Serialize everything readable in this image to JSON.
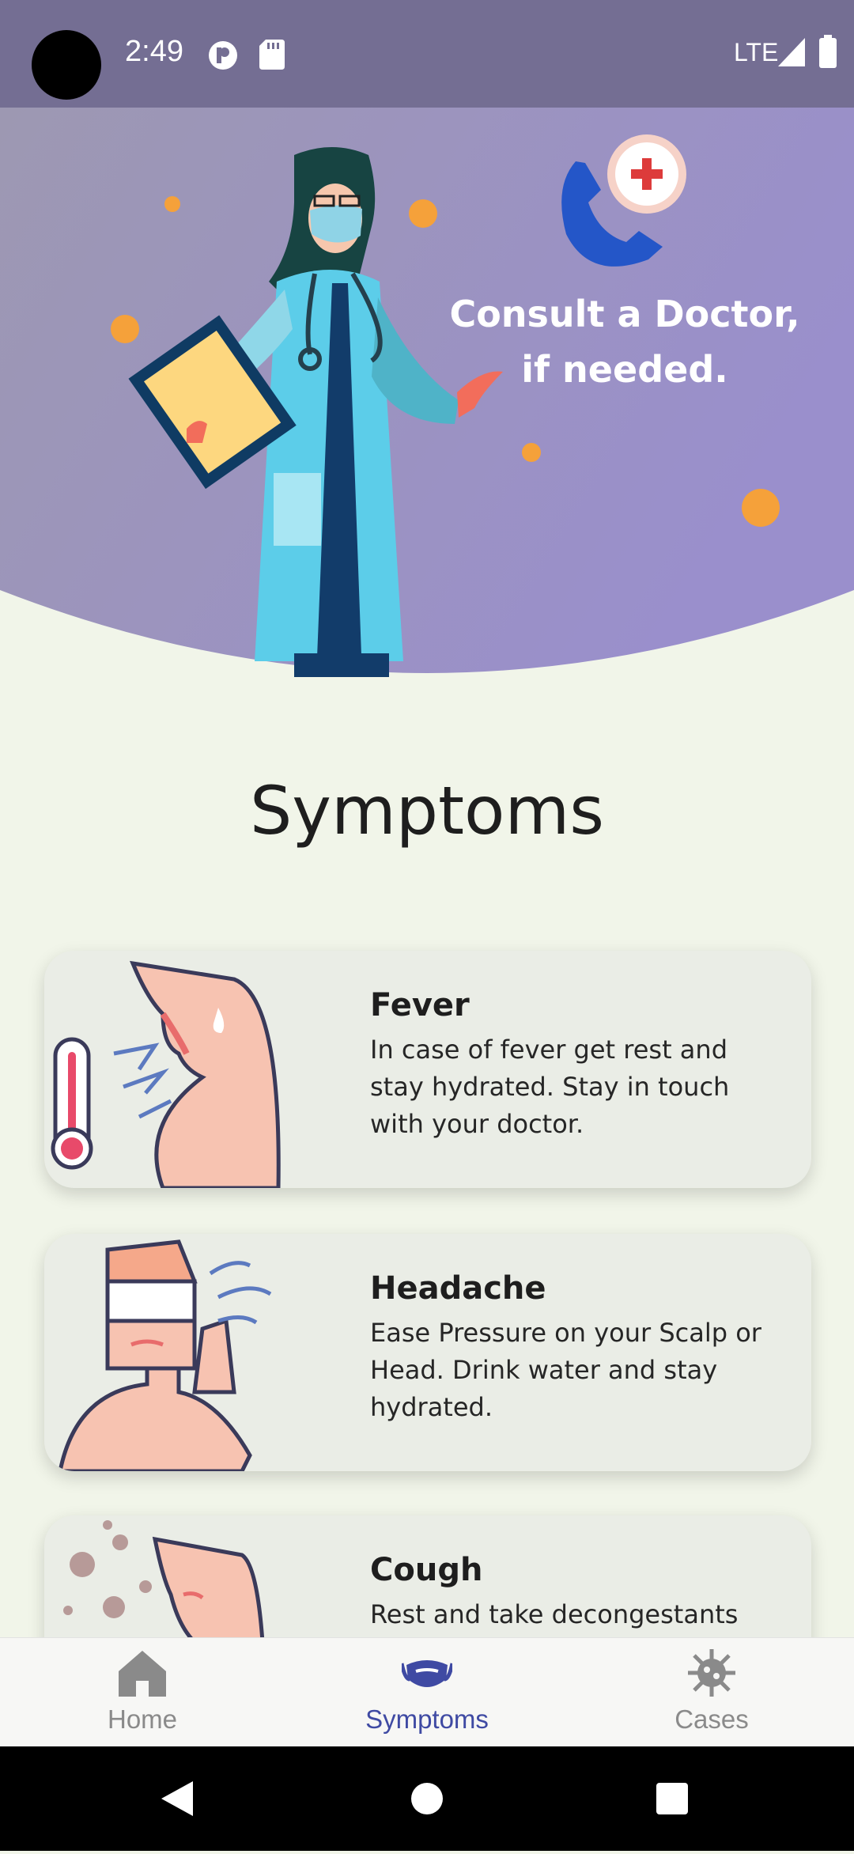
{
  "status_bar": {
    "time": "2:49",
    "network": "LTE",
    "icons": [
      "notification-icon",
      "sd-card-icon",
      "signal-icon",
      "battery-icon"
    ]
  },
  "hero": {
    "line1": "Consult a Doctor,",
    "line2": "if needed.",
    "icons": [
      "doctor-illustration",
      "phone-call-icon",
      "virus-icon"
    ]
  },
  "page_title": "Symptoms",
  "symptoms": [
    {
      "title": "Fever",
      "desc_lines": [
        "In case of fever get rest and",
        "stay hydrated. Stay in touch",
        "with your doctor."
      ]
    },
    {
      "title": "Headache",
      "desc_lines": [
        "Ease Pressure on your Scalp or",
        "Head. Drink water and stay",
        "hydrated."
      ]
    },
    {
      "title": "Cough",
      "desc_lines": [
        "Rest and take decongestants"
      ]
    }
  ],
  "bottom_nav": {
    "items": [
      {
        "label": "Home",
        "icon": "home-icon",
        "active": false
      },
      {
        "label": "Symptoms",
        "icon": "mask-icon",
        "active": true
      },
      {
        "label": "Cases",
        "icon": "virus-icon",
        "active": false
      }
    ]
  },
  "colors": {
    "status_bar": "#746e93",
    "hero_gradient_start": "#9a93b4",
    "hero_gradient_end": "#9a8fca",
    "background": "#f1f5e9",
    "card": "#eaede6",
    "nav_active": "#3f4aa3",
    "nav_inactive": "#8a8a8a"
  }
}
